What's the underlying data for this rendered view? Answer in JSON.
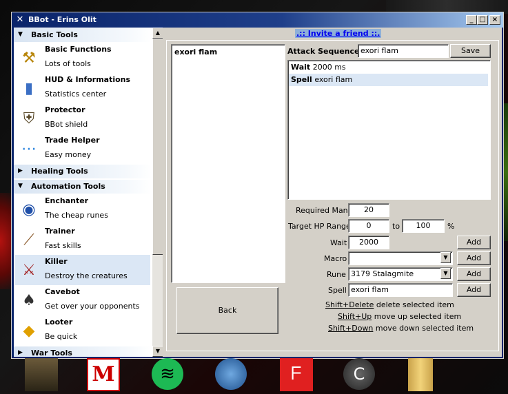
{
  "window": {
    "title": "BBot - Erins Olit"
  },
  "title_buttons": {
    "minimize": "_",
    "maximize": "□",
    "close": "×"
  },
  "invite_link": ".:: Invite a friend ::.",
  "sidebar": {
    "categories": [
      {
        "label": "Basic Tools",
        "expanded": true
      },
      {
        "label": "Healing Tools",
        "expanded": false
      },
      {
        "label": "Automation Tools",
        "expanded": true
      },
      {
        "label": "War Tools",
        "expanded": false
      }
    ],
    "items": [
      {
        "title": "Basic Functions",
        "subtitle": "Lots of tools",
        "icon": "wrench-icon"
      },
      {
        "title": "HUD & Informations",
        "subtitle": "Statistics center",
        "icon": "chart-icon"
      },
      {
        "title": "Protector",
        "subtitle": "BBot shield",
        "icon": "shield-icon"
      },
      {
        "title": "Trade Helper",
        "subtitle": "Easy money",
        "icon": "coins-icon"
      },
      {
        "title": "Enchanter",
        "subtitle": "The cheap runes",
        "icon": "rune-icon"
      },
      {
        "title": "Trainer",
        "subtitle": "Fast skills",
        "icon": "club-icon"
      },
      {
        "title": "Killer",
        "subtitle": "Destroy the creatures",
        "icon": "sword-icon",
        "selected": true
      },
      {
        "title": "Cavebot",
        "subtitle": "Get over your opponents",
        "icon": "tooth-icon"
      },
      {
        "title": "Looter",
        "subtitle": "Be quick",
        "icon": "gold-icon"
      }
    ]
  },
  "spells_list": {
    "items": [
      "exori flam"
    ]
  },
  "back_button": "Back",
  "attack_sequence": {
    "label": "Attack Sequence:",
    "value": "exori flam",
    "save_button": "Save",
    "rows": [
      {
        "type": "Wait",
        "value": "2000 ms"
      },
      {
        "type": "Spell",
        "value": "exori flam",
        "selected": true
      }
    ]
  },
  "form": {
    "required_mana_label": "Required Mana",
    "required_mana_value": "20",
    "target_hp_label": "Target HP Range",
    "target_hp_from": "0",
    "target_hp_to_label": "to",
    "target_hp_to": "100",
    "target_hp_unit": "%",
    "wait_label": "Wait",
    "wait_value": "2000",
    "macro_label": "Macro",
    "macro_value": "",
    "rune_label": "Rune",
    "rune_value": "3179 Stalagmite",
    "spell_label": "Spell",
    "spell_value": "exori flam",
    "add_button": "Add"
  },
  "hints": [
    {
      "key": "Shift+Delete",
      "text": " delete selected item"
    },
    {
      "key": "Shift+Up",
      "text": " move up selected item"
    },
    {
      "key": "Shift+Down",
      "text": " move down selected item"
    }
  ]
}
